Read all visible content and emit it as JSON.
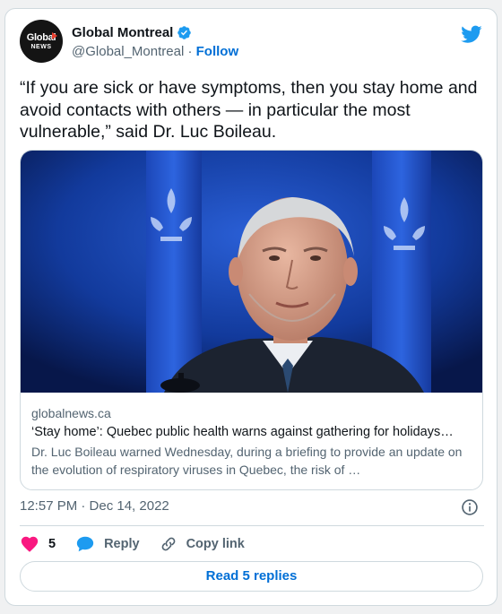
{
  "author": {
    "avatar_text_top": "Global",
    "avatar_text_bottom": "NEWS",
    "display_name": "Global Montreal",
    "handle": "@Global_Montreal",
    "separator": " · ",
    "follow_label": "Follow",
    "verified": true
  },
  "tweet": {
    "text": "“If you are sick or have symptoms, then you stay home and avoid contacts with others — in particular the most vulnerable,” said Dr. Luc Boileau.",
    "timestamp": "12:57 PM · Dec 14, 2022"
  },
  "link_card": {
    "domain": "globalnews.ca",
    "title": "‘Stay home’: Quebec public health warns against gathering for holidays…",
    "description": "Dr. Luc Boileau warned Wednesday, during a briefing to provide an update on the evolution of respiratory viruses in Quebec, the risk of …",
    "image_icon": "photo-man-at-podium-quebec-flags"
  },
  "actions": {
    "like_count": "5",
    "reply_label": "Reply",
    "copy_link_label": "Copy link"
  },
  "read_replies_label": "Read 5 replies",
  "colors": {
    "accent": "#006fd6",
    "twitter_blue": "#1d9bf0",
    "like_pink": "#f91880",
    "secondary_text": "#536471",
    "border": "#cfd9de"
  }
}
